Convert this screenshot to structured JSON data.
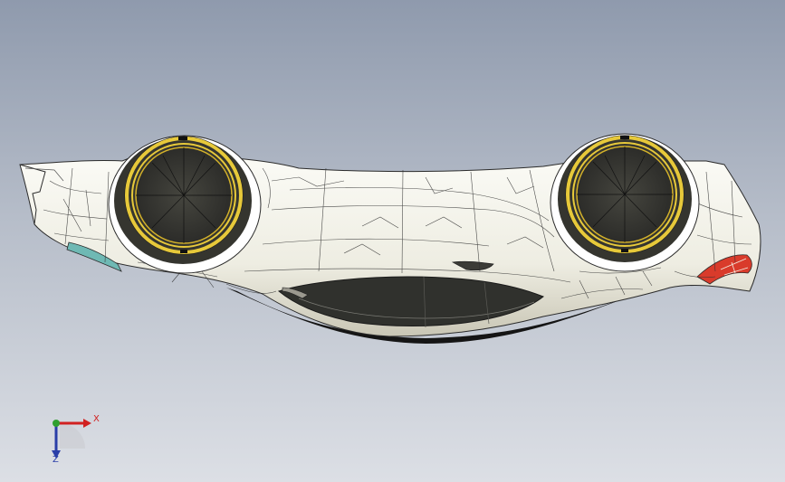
{
  "viewport": {
    "background_top": "#8f9aad",
    "background_bottom": "#dcdfe5"
  },
  "model": {
    "description_name": "car-body-surface-model",
    "body_color": "#f4f3ea",
    "edge_color": "#2b2b2b",
    "wheel_well_color": "#3a3a37",
    "wheel_ring_color": "#e7c93a",
    "accent_red": "#d93b2b",
    "accent_teal": "#6fb9b4"
  },
  "triad": {
    "x_label": "X",
    "z_label": "Z",
    "x_color": "#d12020",
    "y_color": "#2fa02f",
    "z_color": "#2a3ea8"
  }
}
